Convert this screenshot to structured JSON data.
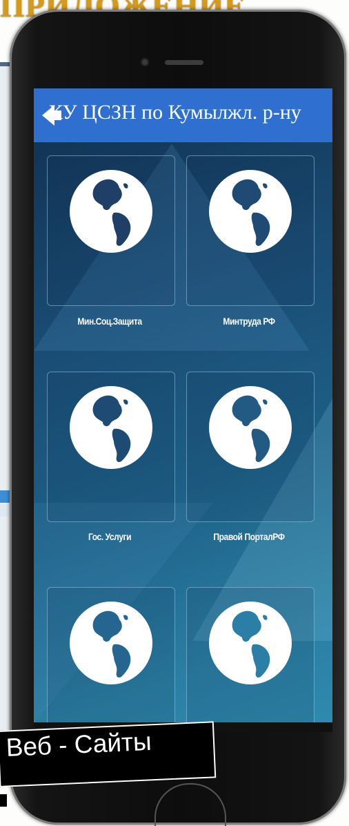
{
  "slide": {
    "title": "ПРИЛОЖЕНИЕ"
  },
  "app": {
    "title": "КУ ЦСЗН по Кумылжл. р-ну",
    "back_icon": "back-arrow-icon",
    "bar_color": "#2f6fcf"
  },
  "tiles": [
    {
      "label": "Мин.Соц.Защита",
      "icon": "globe-icon"
    },
    {
      "label": "Минтруда РФ",
      "icon": "globe-icon"
    },
    {
      "label": "Гос. Услуги",
      "icon": "globe-icon"
    },
    {
      "label": "Правой ПорталРФ",
      "icon": "globe-icon"
    },
    {
      "label": "",
      "icon": "globe-icon"
    },
    {
      "label": "",
      "icon": "globe-icon"
    }
  ],
  "caption": {
    "text": "Веб - Сайты"
  }
}
